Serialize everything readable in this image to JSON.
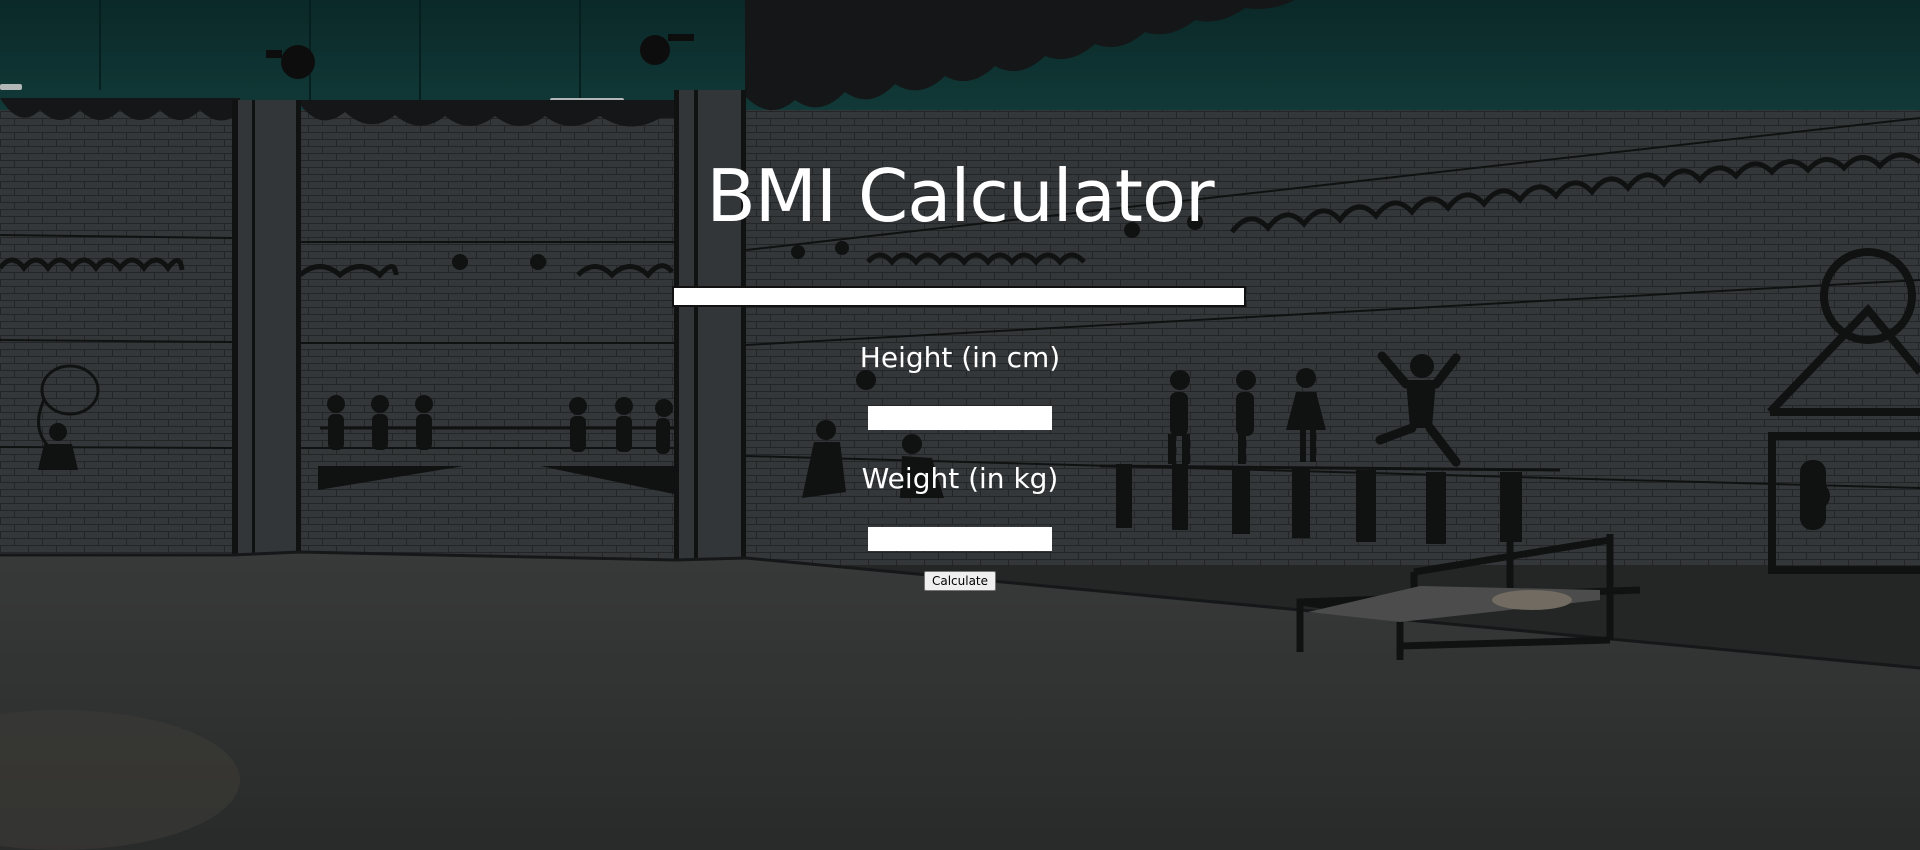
{
  "page": {
    "title": "BMI Calculator",
    "result_text": ""
  },
  "form": {
    "height_label": "Height (in cm)",
    "height_value": "",
    "weight_label": "Weight (in kg)",
    "weight_value": "",
    "calculate_label": "Calculate"
  },
  "colors": {
    "text": "#ffffff",
    "ceiling": "#123c3b",
    "wall": "#3e4244",
    "floor": "#404242"
  },
  "icons": {
    "background": "gym-wall-mural-illustration"
  }
}
